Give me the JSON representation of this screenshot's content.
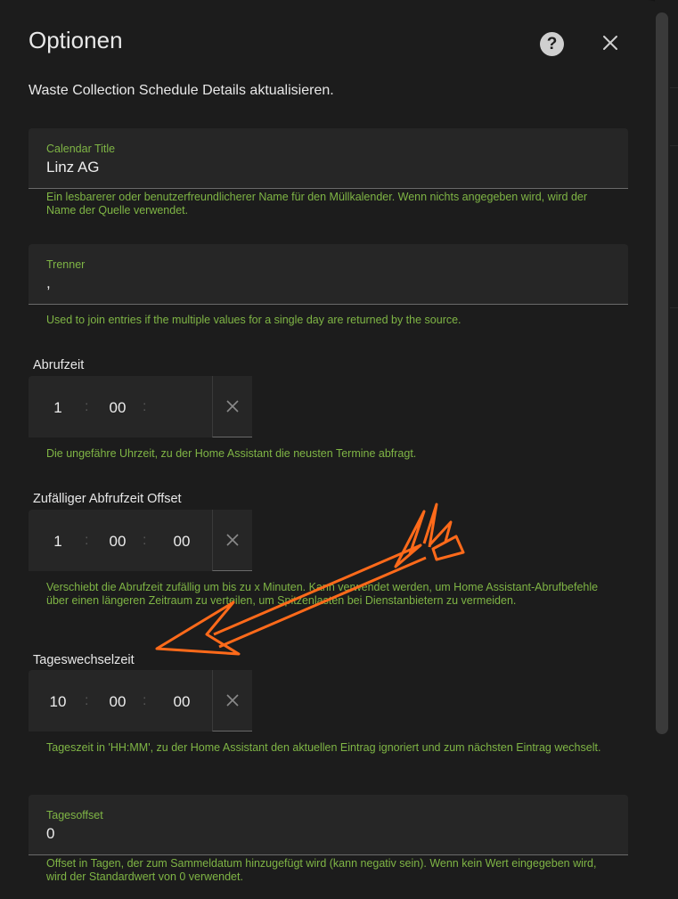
{
  "dialog": {
    "title": "Optionen",
    "subtitle": "Waste Collection Schedule Details aktualisieren."
  },
  "fields": {
    "calendar_title": {
      "label": "Calendar Title",
      "value": "Linz AG",
      "helper": "Ein lesbarerer oder benutzerfreundlicherer Name für den Müllkalender. Wenn nichts angegeben wird, wird der Name der Quelle verwendet."
    },
    "separator": {
      "label": "Trenner",
      "value": ",",
      "helper": "Used to join entries if the multiple values for a single day are returned by the source."
    },
    "fetch_time": {
      "label": "Abrufzeit",
      "hours": "1",
      "minutes": "00",
      "seconds": "",
      "sep": ":",
      "helper": "Die ungefähre Uhrzeit, zu der Home Assistant die neusten Termine abfragt."
    },
    "random_offset": {
      "label": "Zufälliger Abfrufzeit Offset",
      "hours": "1",
      "minutes": "00",
      "seconds": "00",
      "sep": ":",
      "helper": "Verschiebt die Abrufzeit zufällig um bis zu x Minuten. Kann verwendet werden, um Home Assistant-Abrufbefehle über einen längeren Zeitraum zu verteilen, um Spitzenlasten bei Dienstanbietern zu vermeiden."
    },
    "day_switch_time": {
      "label": "Tageswechselzeit",
      "hours": "10",
      "minutes": "00",
      "seconds": "00",
      "sep": ":",
      "helper": "Tageszeit in 'HH:MM', zu der Home Assistant den aktuellen Eintrag ignoriert und zum nächsten Eintrag wechselt."
    },
    "day_offset": {
      "label": "Tagesoffset",
      "value": "0",
      "helper": "Offset in Tagen, der zum Sammeldatum hinzugefügt wird (kann negativ sein). Wenn kein Wert eingegeben wird, wird der Standardwert von 0 verwendet."
    }
  },
  "icons": {
    "help": "help-circle-icon",
    "close": "close-icon",
    "clear": "clear-x-icon",
    "annotation": "orange-arrow-icon"
  },
  "colors": {
    "accent": "#7fb545",
    "arrow": "#ff6a1a",
    "surface": "#1c1c1c",
    "field": "#262626"
  }
}
